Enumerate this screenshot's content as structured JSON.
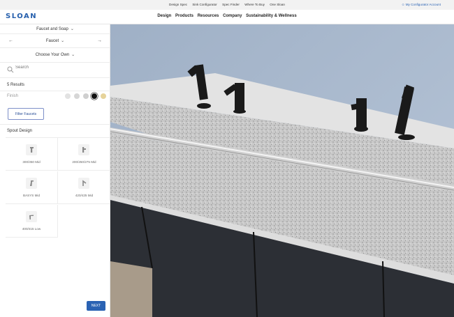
{
  "topbar": {
    "links": [
      "Design Spec",
      "Sink Configurator",
      "Spec Finder",
      "Where To Buy",
      "One Sloan"
    ],
    "account": "My Configurator Account"
  },
  "header": {
    "logo": "SLOAN",
    "nav": [
      "Design",
      "Products",
      "Resources",
      "Company",
      "Sustainability & Wellness"
    ]
  },
  "sidebar": {
    "category": "Faucet and Soap",
    "product": "Faucet",
    "mode": "Choose Your Own",
    "search_placeholder": "Search",
    "results": "5 Results",
    "finish_label": "Finish",
    "finish_colors": [
      "#e2e2e2",
      "#d6d6d6",
      "#cfcfcf",
      "#111111",
      "#e6d39a"
    ],
    "filter_button": "Filter Faucets",
    "spout_label": "Spout Design",
    "spouts": [
      {
        "label": "300/350 Mid"
      },
      {
        "label": "200/250/275 Mid"
      },
      {
        "label": "BASYS Mid"
      },
      {
        "label": "420/425 Mid"
      },
      {
        "label": "400/415 Low"
      }
    ],
    "next_button": "NEXT"
  },
  "colors": {
    "brand": "#2760ad",
    "button": "#2a62b3"
  }
}
